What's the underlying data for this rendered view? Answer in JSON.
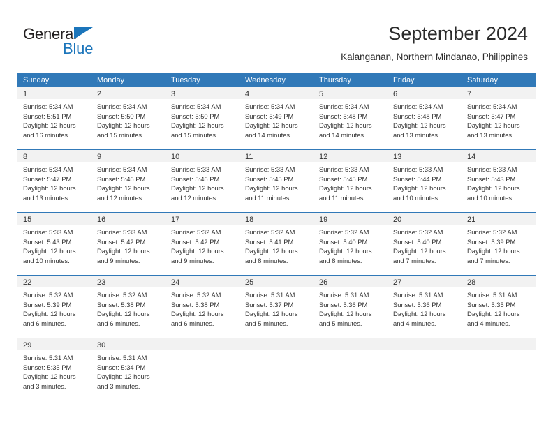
{
  "brand": {
    "name_part1": "General",
    "name_part2": "Blue",
    "accent_color": "#1b75bb"
  },
  "header": {
    "month_title": "September 2024",
    "location": "Kalanganan, Northern Mindanao, Philippines"
  },
  "theme": {
    "header_blue": "#3179b8",
    "day_band_gray": "#f2f2f2",
    "text": "#333333"
  },
  "weekdays": [
    "Sunday",
    "Monday",
    "Tuesday",
    "Wednesday",
    "Thursday",
    "Friday",
    "Saturday"
  ],
  "weeks": [
    [
      {
        "day": "1",
        "sunrise": "Sunrise: 5:34 AM",
        "sunset": "Sunset: 5:51 PM",
        "daylight1": "Daylight: 12 hours",
        "daylight2": "and 16 minutes."
      },
      {
        "day": "2",
        "sunrise": "Sunrise: 5:34 AM",
        "sunset": "Sunset: 5:50 PM",
        "daylight1": "Daylight: 12 hours",
        "daylight2": "and 15 minutes."
      },
      {
        "day": "3",
        "sunrise": "Sunrise: 5:34 AM",
        "sunset": "Sunset: 5:50 PM",
        "daylight1": "Daylight: 12 hours",
        "daylight2": "and 15 minutes."
      },
      {
        "day": "4",
        "sunrise": "Sunrise: 5:34 AM",
        "sunset": "Sunset: 5:49 PM",
        "daylight1": "Daylight: 12 hours",
        "daylight2": "and 14 minutes."
      },
      {
        "day": "5",
        "sunrise": "Sunrise: 5:34 AM",
        "sunset": "Sunset: 5:48 PM",
        "daylight1": "Daylight: 12 hours",
        "daylight2": "and 14 minutes."
      },
      {
        "day": "6",
        "sunrise": "Sunrise: 5:34 AM",
        "sunset": "Sunset: 5:48 PM",
        "daylight1": "Daylight: 12 hours",
        "daylight2": "and 13 minutes."
      },
      {
        "day": "7",
        "sunrise": "Sunrise: 5:34 AM",
        "sunset": "Sunset: 5:47 PM",
        "daylight1": "Daylight: 12 hours",
        "daylight2": "and 13 minutes."
      }
    ],
    [
      {
        "day": "8",
        "sunrise": "Sunrise: 5:34 AM",
        "sunset": "Sunset: 5:47 PM",
        "daylight1": "Daylight: 12 hours",
        "daylight2": "and 13 minutes."
      },
      {
        "day": "9",
        "sunrise": "Sunrise: 5:34 AM",
        "sunset": "Sunset: 5:46 PM",
        "daylight1": "Daylight: 12 hours",
        "daylight2": "and 12 minutes."
      },
      {
        "day": "10",
        "sunrise": "Sunrise: 5:33 AM",
        "sunset": "Sunset: 5:46 PM",
        "daylight1": "Daylight: 12 hours",
        "daylight2": "and 12 minutes."
      },
      {
        "day": "11",
        "sunrise": "Sunrise: 5:33 AM",
        "sunset": "Sunset: 5:45 PM",
        "daylight1": "Daylight: 12 hours",
        "daylight2": "and 11 minutes."
      },
      {
        "day": "12",
        "sunrise": "Sunrise: 5:33 AM",
        "sunset": "Sunset: 5:45 PM",
        "daylight1": "Daylight: 12 hours",
        "daylight2": "and 11 minutes."
      },
      {
        "day": "13",
        "sunrise": "Sunrise: 5:33 AM",
        "sunset": "Sunset: 5:44 PM",
        "daylight1": "Daylight: 12 hours",
        "daylight2": "and 10 minutes."
      },
      {
        "day": "14",
        "sunrise": "Sunrise: 5:33 AM",
        "sunset": "Sunset: 5:43 PM",
        "daylight1": "Daylight: 12 hours",
        "daylight2": "and 10 minutes."
      }
    ],
    [
      {
        "day": "15",
        "sunrise": "Sunrise: 5:33 AM",
        "sunset": "Sunset: 5:43 PM",
        "daylight1": "Daylight: 12 hours",
        "daylight2": "and 10 minutes."
      },
      {
        "day": "16",
        "sunrise": "Sunrise: 5:33 AM",
        "sunset": "Sunset: 5:42 PM",
        "daylight1": "Daylight: 12 hours",
        "daylight2": "and 9 minutes."
      },
      {
        "day": "17",
        "sunrise": "Sunrise: 5:32 AM",
        "sunset": "Sunset: 5:42 PM",
        "daylight1": "Daylight: 12 hours",
        "daylight2": "and 9 minutes."
      },
      {
        "day": "18",
        "sunrise": "Sunrise: 5:32 AM",
        "sunset": "Sunset: 5:41 PM",
        "daylight1": "Daylight: 12 hours",
        "daylight2": "and 8 minutes."
      },
      {
        "day": "19",
        "sunrise": "Sunrise: 5:32 AM",
        "sunset": "Sunset: 5:40 PM",
        "daylight1": "Daylight: 12 hours",
        "daylight2": "and 8 minutes."
      },
      {
        "day": "20",
        "sunrise": "Sunrise: 5:32 AM",
        "sunset": "Sunset: 5:40 PM",
        "daylight1": "Daylight: 12 hours",
        "daylight2": "and 7 minutes."
      },
      {
        "day": "21",
        "sunrise": "Sunrise: 5:32 AM",
        "sunset": "Sunset: 5:39 PM",
        "daylight1": "Daylight: 12 hours",
        "daylight2": "and 7 minutes."
      }
    ],
    [
      {
        "day": "22",
        "sunrise": "Sunrise: 5:32 AM",
        "sunset": "Sunset: 5:39 PM",
        "daylight1": "Daylight: 12 hours",
        "daylight2": "and 6 minutes."
      },
      {
        "day": "23",
        "sunrise": "Sunrise: 5:32 AM",
        "sunset": "Sunset: 5:38 PM",
        "daylight1": "Daylight: 12 hours",
        "daylight2": "and 6 minutes."
      },
      {
        "day": "24",
        "sunrise": "Sunrise: 5:32 AM",
        "sunset": "Sunset: 5:38 PM",
        "daylight1": "Daylight: 12 hours",
        "daylight2": "and 6 minutes."
      },
      {
        "day": "25",
        "sunrise": "Sunrise: 5:31 AM",
        "sunset": "Sunset: 5:37 PM",
        "daylight1": "Daylight: 12 hours",
        "daylight2": "and 5 minutes."
      },
      {
        "day": "26",
        "sunrise": "Sunrise: 5:31 AM",
        "sunset": "Sunset: 5:36 PM",
        "daylight1": "Daylight: 12 hours",
        "daylight2": "and 5 minutes."
      },
      {
        "day": "27",
        "sunrise": "Sunrise: 5:31 AM",
        "sunset": "Sunset: 5:36 PM",
        "daylight1": "Daylight: 12 hours",
        "daylight2": "and 4 minutes."
      },
      {
        "day": "28",
        "sunrise": "Sunrise: 5:31 AM",
        "sunset": "Sunset: 5:35 PM",
        "daylight1": "Daylight: 12 hours",
        "daylight2": "and 4 minutes."
      }
    ],
    [
      {
        "day": "29",
        "sunrise": "Sunrise: 5:31 AM",
        "sunset": "Sunset: 5:35 PM",
        "daylight1": "Daylight: 12 hours",
        "daylight2": "and 3 minutes."
      },
      {
        "day": "30",
        "sunrise": "Sunrise: 5:31 AM",
        "sunset": "Sunset: 5:34 PM",
        "daylight1": "Daylight: 12 hours",
        "daylight2": "and 3 minutes."
      },
      {
        "day": "",
        "sunrise": "",
        "sunset": "",
        "daylight1": "",
        "daylight2": ""
      },
      {
        "day": "",
        "sunrise": "",
        "sunset": "",
        "daylight1": "",
        "daylight2": ""
      },
      {
        "day": "",
        "sunrise": "",
        "sunset": "",
        "daylight1": "",
        "daylight2": ""
      },
      {
        "day": "",
        "sunrise": "",
        "sunset": "",
        "daylight1": "",
        "daylight2": ""
      },
      {
        "day": "",
        "sunrise": "",
        "sunset": "",
        "daylight1": "",
        "daylight2": ""
      }
    ]
  ]
}
